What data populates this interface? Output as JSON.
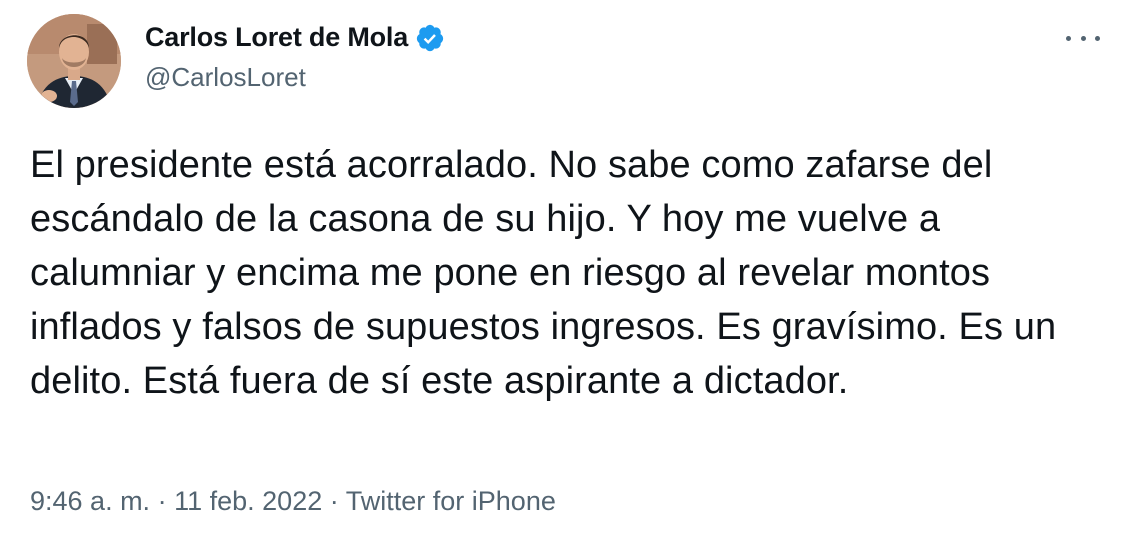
{
  "author": {
    "display_name": "Carlos Loret de Mola",
    "handle": "@CarlosLoret",
    "verified_icon": "verified-badge-icon",
    "accent_color": "#1d9bf0"
  },
  "tweet": {
    "text": "El presidente está acorralado. No sabe como zafarse del escándalo de la casona de su hijo. Y hoy me vuelve a calumniar y encima me pone en riesgo al revelar montos inflados y falsos de supuestos ingresos. Es gravísimo. Es un delito. Está fuera de sí este aspirante a dictador."
  },
  "meta": {
    "time": "9:46 a. m.",
    "separator": "·",
    "date": "11 feb. 2022",
    "source": "Twitter for iPhone"
  },
  "actions": {
    "more_icon": "more-options-icon"
  }
}
